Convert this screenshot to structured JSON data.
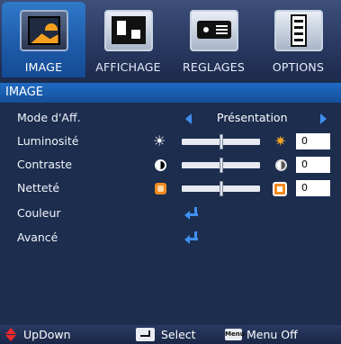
{
  "tabs": [
    {
      "label": "IMAGE",
      "icon": "image-icon",
      "active": true
    },
    {
      "label": "AFFICHAGE",
      "icon": "display-icon",
      "active": false
    },
    {
      "label": "REGLAGES",
      "icon": "projector-icon",
      "active": false
    },
    {
      "label": "OPTIONS",
      "icon": "options-icon",
      "active": false
    }
  ],
  "section": {
    "title": "IMAGE"
  },
  "menu": {
    "mode": {
      "label": "Mode d'Aff.",
      "value": "Présentation"
    },
    "brightness": {
      "label": "Luminosité",
      "value": "0",
      "icon_low": "sun-dim-icon",
      "icon_high": "sun-bright-icon"
    },
    "contrast": {
      "label": "Contraste",
      "value": "0",
      "icon_low": "contrast-low-icon",
      "icon_high": "contrast-high-icon"
    },
    "sharpness": {
      "label": "Netteté",
      "value": "0",
      "icon_low": "sharpness-low-icon",
      "icon_high": "sharpness-high-icon"
    },
    "color": {
      "label": "Couleur",
      "icon": "enter-icon"
    },
    "advanced": {
      "label": "Avancé",
      "icon": "enter-icon"
    }
  },
  "sliders": {
    "brightness_level": 0.5,
    "contrast_level": 0.5,
    "sharpness_level": 0.5
  },
  "footer": {
    "updown_label": "UpDown",
    "select_label": "Select",
    "menu_key": "Menu",
    "menu_label": "Menu Off"
  },
  "colors": {
    "accent": "#1f6cc2",
    "background": "#1c2d4e",
    "arrow": "#3f8ff0",
    "orange": "#f28a1e",
    "red": "#e8282a"
  }
}
